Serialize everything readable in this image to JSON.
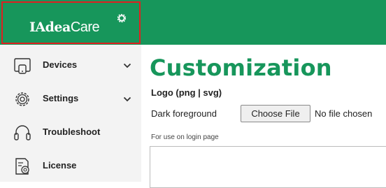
{
  "header": {
    "brand_bold": "IAdea",
    "brand_light": "Care",
    "accent_color": "#17965b",
    "highlight_color": "#e02020"
  },
  "sidebar": {
    "items": [
      {
        "label": "Devices",
        "icon": "monitor-icon",
        "expandable": true
      },
      {
        "label": "Settings",
        "icon": "gear-icon",
        "expandable": true
      },
      {
        "label": "Troubleshoot",
        "icon": "headset-icon",
        "expandable": false
      },
      {
        "label": "License",
        "icon": "license-icon",
        "expandable": false
      }
    ]
  },
  "main": {
    "title": "Customization",
    "logo_section_label": "Logo (png | svg)",
    "dark_foreground_label": "Dark foreground",
    "choose_file_label": "Choose File",
    "no_file_text": "No file chosen",
    "hint": "For use on login page"
  }
}
